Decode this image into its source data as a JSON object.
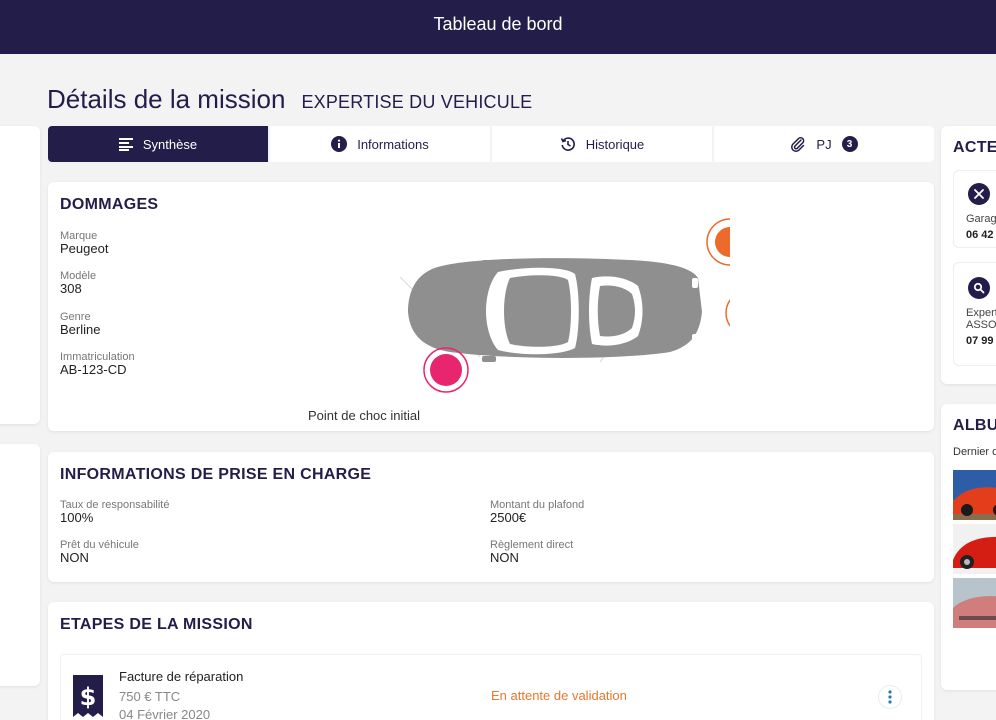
{
  "header": {
    "title": "Tableau de bord"
  },
  "page": {
    "title": "Détails de la mission",
    "subtitle": "EXPERTISE DU VEHICULE"
  },
  "tabs": [
    {
      "label": "Synthèse",
      "icon": "list-icon",
      "active": true
    },
    {
      "label": "Informations",
      "icon": "info-icon",
      "active": false
    },
    {
      "label": "Historique",
      "icon": "history-icon",
      "active": false
    },
    {
      "label": "PJ",
      "icon": "paperclip-icon",
      "active": false,
      "badge": "3"
    }
  ],
  "dommages": {
    "title": "DOMMAGES",
    "fields": [
      {
        "label": "Marque",
        "value": "Peugeot"
      },
      {
        "label": "Modèle",
        "value": "308"
      },
      {
        "label": "Genre",
        "value": "Berline"
      },
      {
        "label": "Immatriculation",
        "value": "AB-123-CD"
      }
    ],
    "impact_caption": "Point de choc initial",
    "colors": {
      "impact_initial": "#e8266f",
      "impact_other": "#ec6a2c",
      "car": "#8f8f8f"
    }
  },
  "prise_en_charge": {
    "title": "INFORMATIONS DE PRISE EN CHARGE",
    "fields": [
      {
        "label": "Taux de responsabilité",
        "value": "100%"
      },
      {
        "label": "Montant du plafond",
        "value": "2500€"
      },
      {
        "label": "Prêt du véhicule",
        "value": "NON"
      },
      {
        "label": "Règlement direct",
        "value": "NON"
      }
    ]
  },
  "etapes": {
    "title": "ETAPES DE LA MISSION",
    "items": [
      {
        "name": "Facture de réparation",
        "amount": "750 € TTC",
        "date": "04 Février 2020",
        "status": "En attente de validation",
        "icon": "dollar-icon"
      }
    ]
  },
  "acteurs": {
    "title": "ACTE",
    "items": [
      {
        "icon": "tools-icon",
        "role": "Garag",
        "role2": "",
        "phone": "06 42"
      },
      {
        "icon": "search-icon",
        "role": "Expert",
        "role2": "ASSO",
        "phone": "07 99"
      }
    ]
  },
  "album": {
    "title": "ALBU",
    "subtitle": "Dernier d"
  },
  "theme": {
    "primary": "#231d4a",
    "accent_orange": "#e8772e",
    "background": "#f3f3f4"
  }
}
